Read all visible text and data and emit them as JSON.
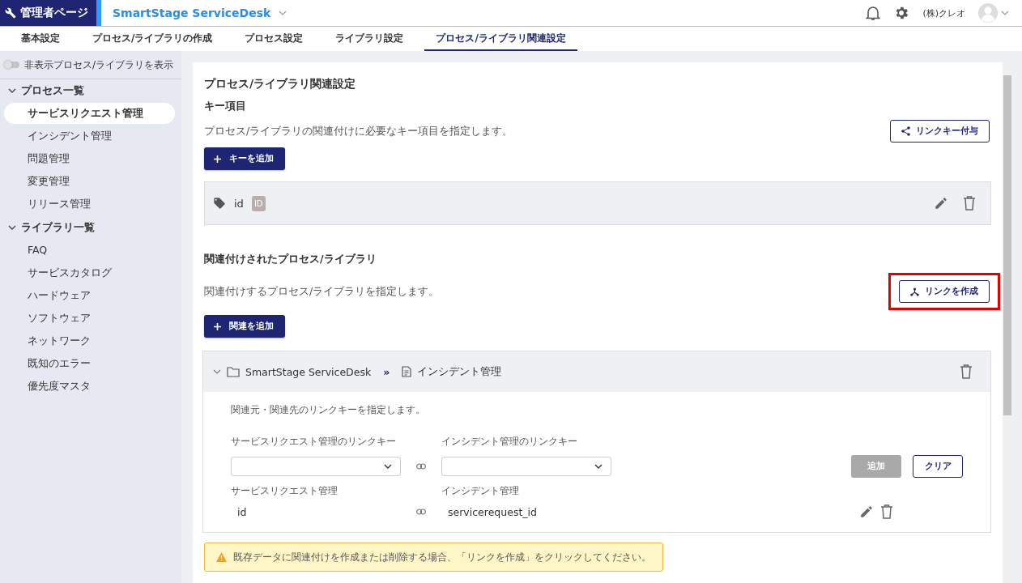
{
  "header": {
    "brand": "管理者ページ",
    "product": "SmartStage ServiceDesk",
    "company": "(株)クレオ"
  },
  "tabs": [
    {
      "label": "基本設定",
      "selected": false
    },
    {
      "label": "プロセス/ライブラリの作成",
      "selected": false
    },
    {
      "label": "プロセス設定",
      "selected": false
    },
    {
      "label": "ライブラリ設定",
      "selected": false
    },
    {
      "label": "プロセス/ライブラリ関連設定",
      "selected": true
    }
  ],
  "sidebar": {
    "toggle": {
      "label": "非表示プロセス/ライブラリを表示",
      "on": false
    },
    "groups": [
      {
        "label": "プロセス一覧",
        "expanded": true,
        "children": [
          {
            "label": "サービスリクエスト管理",
            "selected": true
          },
          {
            "label": "インシデント管理",
            "selected": false
          },
          {
            "label": "問題管理",
            "selected": false
          },
          {
            "label": "変更管理",
            "selected": false
          },
          {
            "label": "リリース管理",
            "selected": false
          }
        ]
      },
      {
        "label": "ライブラリ一覧",
        "expanded": true,
        "children": [
          {
            "label": "FAQ",
            "selected": false
          },
          {
            "label": "サービスカタログ",
            "selected": false
          },
          {
            "label": "ハードウェア",
            "selected": false
          },
          {
            "label": "ソフトウェア",
            "selected": false
          },
          {
            "label": "ネットワーク",
            "selected": false
          },
          {
            "label": "既知のエラー",
            "selected": false
          },
          {
            "label": "優先度マスタ",
            "selected": false
          }
        ]
      }
    ]
  },
  "main": {
    "title": "プロセス/ライブラリ関連設定",
    "key_section": {
      "heading": "キー項目",
      "description": "プロセス/ライブラリの関連付けに必要なキー項目を指定します。",
      "link_key_button": "リンクキー付与",
      "add_key_button": "キーを追加",
      "keys": [
        {
          "name": "id",
          "badge": "ID"
        }
      ]
    },
    "relation_section": {
      "heading": "関連付けされたプロセス/ライブラリ",
      "description": "関連付けするプロセス/ライブラリを指定します。",
      "create_link_button": {
        "label": "リンクを作成",
        "highlighted": true
      },
      "add_relation_button": "関連を追加",
      "relations": [
        {
          "source": "SmartStage ServiceDesk",
          "separator": "»",
          "target": "インシデント管理",
          "expanded": true,
          "description": "関連元・関連先のリンクキーを指定します。",
          "source_key_label": "サービスリクエスト管理のリンクキー",
          "target_key_label": "インシデント管理のリンクキー",
          "add_button": {
            "label": "追加",
            "disabled": true
          },
          "clear_button": "クリア",
          "source_name": "サービスリクエスト管理",
          "target_name": "インシデント管理",
          "links": [
            {
              "source": "id",
              "target": "servicerequest_id"
            }
          ]
        }
      ]
    },
    "warning": "既存データに関連付けを作成または削除する場合、「リンクを作成」をクリックしてください。"
  }
}
